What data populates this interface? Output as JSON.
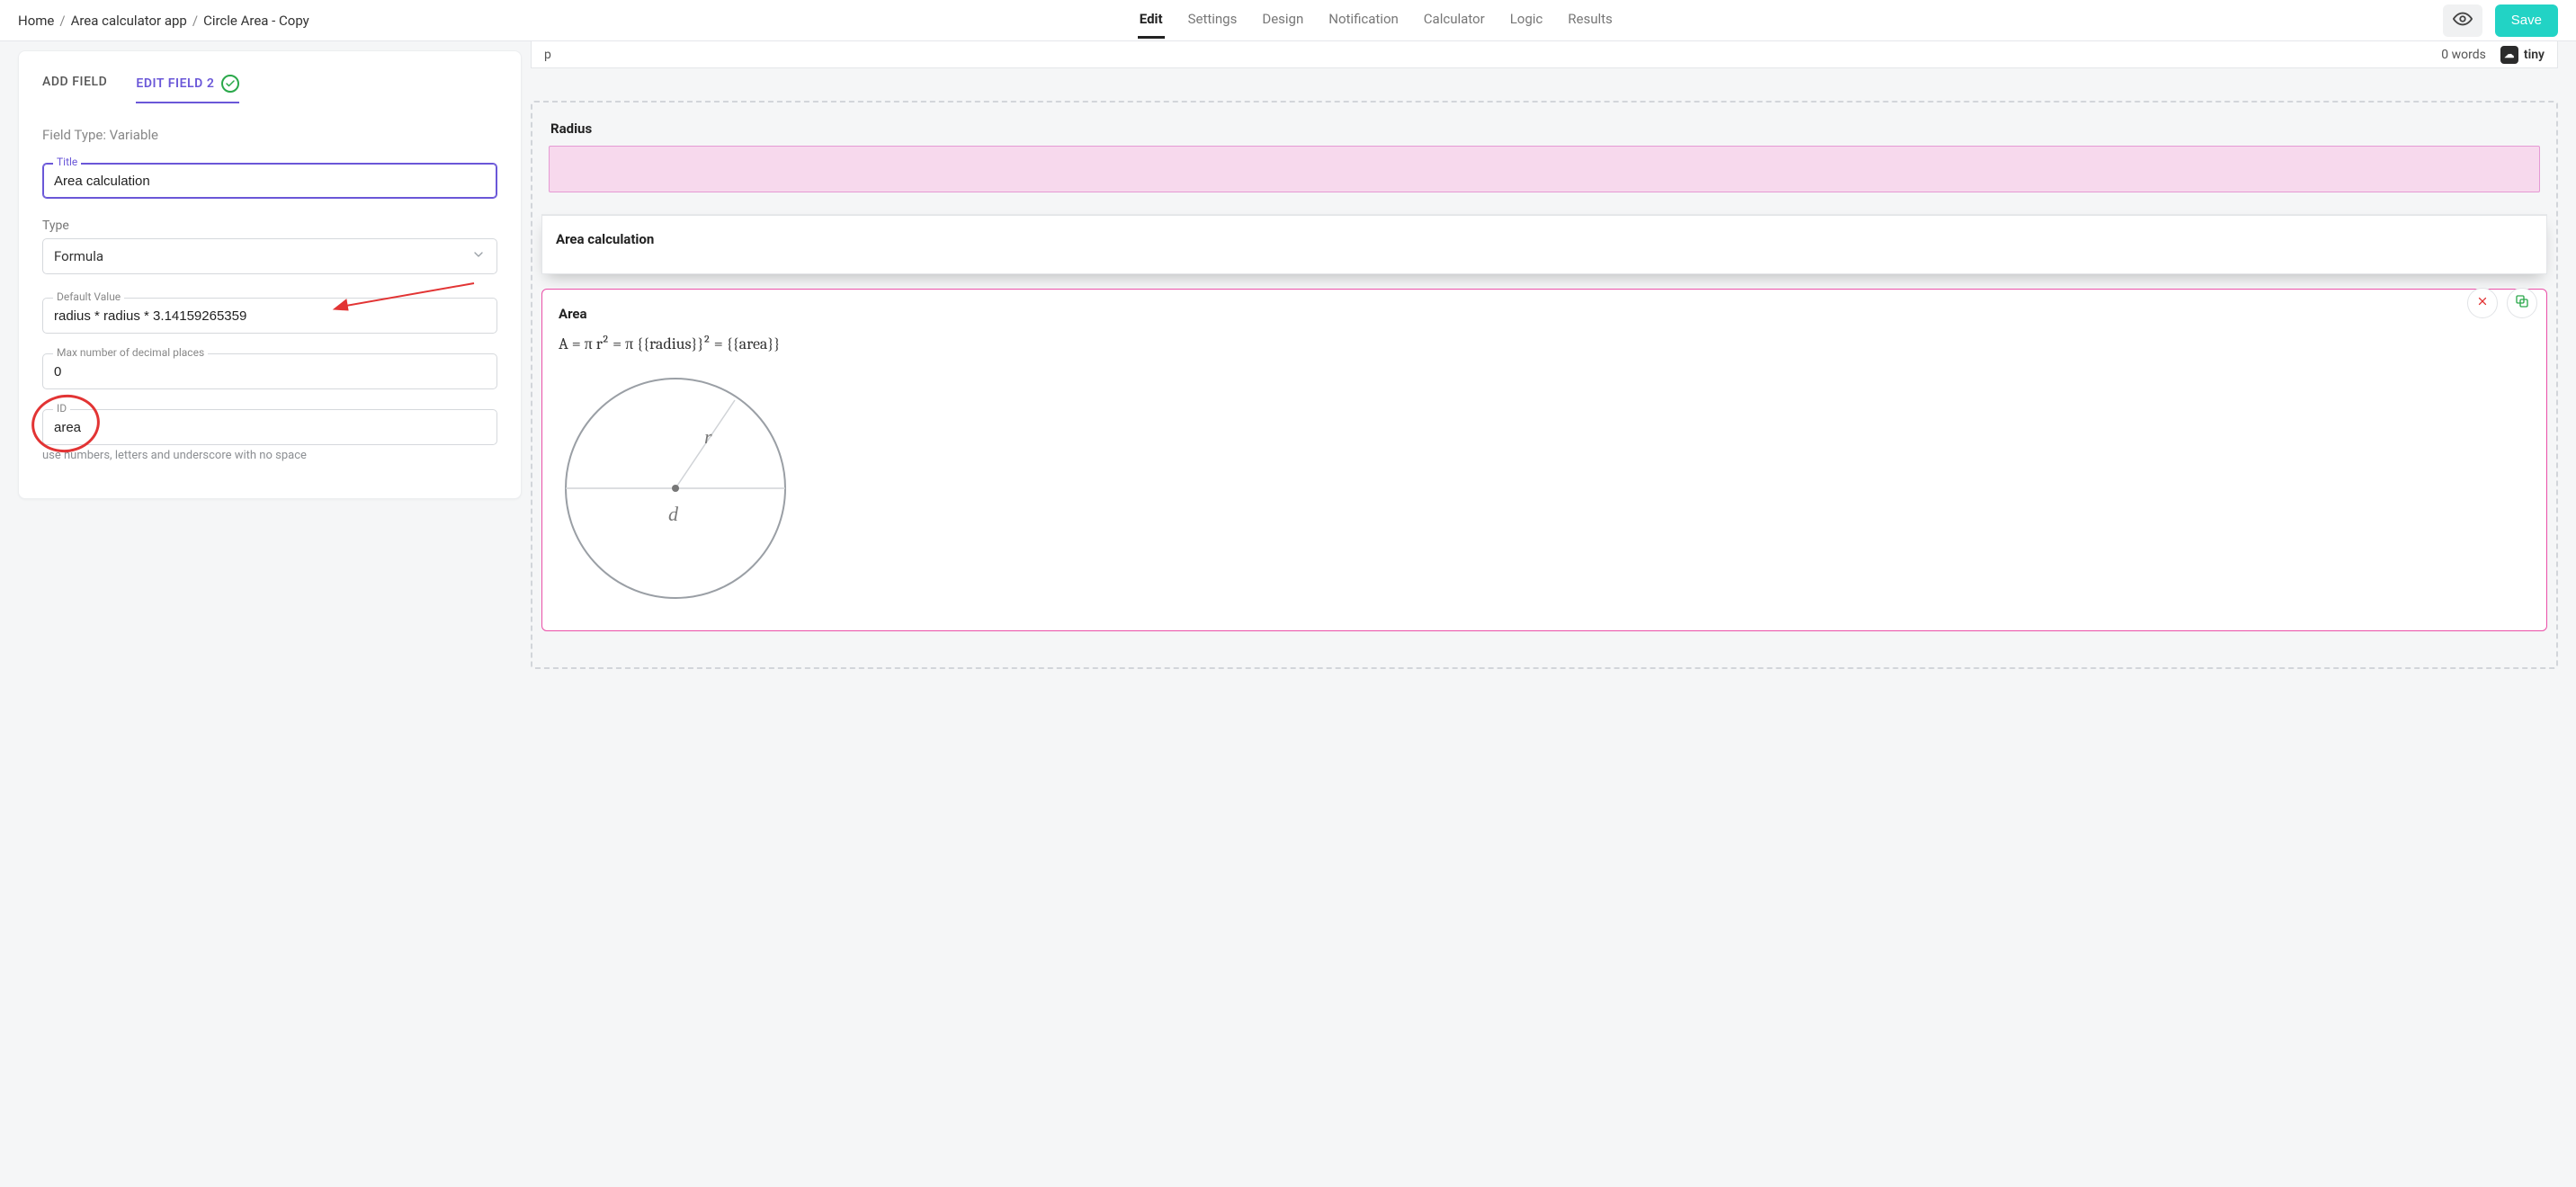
{
  "breadcrumb": {
    "home": "Home",
    "app": "Area calculator app",
    "page": "Circle Area - Copy"
  },
  "tabs": {
    "edit": "Edit",
    "settings": "Settings",
    "design": "Design",
    "notification": "Notification",
    "calculator": "Calculator",
    "logic": "Logic",
    "results": "Results"
  },
  "topbar": {
    "save": "Save"
  },
  "panel": {
    "add_field": "ADD FIELD",
    "edit_field": "EDIT FIELD 2",
    "field_type_line": "Field Type: Variable",
    "title_label": "Title",
    "title_value": "Area calculation",
    "type_label": "Type",
    "type_value": "Formula",
    "default_label": "Default Value",
    "default_value": "radius * radius * 3.14159265359",
    "decimals_label": "Max number of decimal places",
    "decimals_value": "0",
    "id_label": "ID",
    "id_value": "area",
    "id_hint": "use numbers, letters and underscore with no space"
  },
  "editor": {
    "path": "p",
    "words": "0 words",
    "brand": "tiny"
  },
  "preview": {
    "radius_title": "Radius",
    "calc_title": "Area calculation",
    "area_title": "Area",
    "formula_html": "A = π r² = π  {{radius}}² = {{area}}",
    "diagram": {
      "r_label": "r",
      "d_label": "d"
    }
  }
}
